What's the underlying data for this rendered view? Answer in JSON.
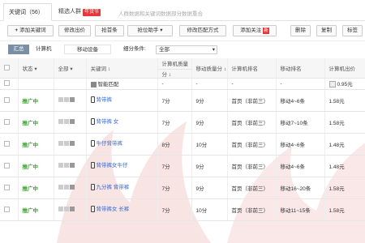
{
  "tabs": {
    "keywords": "关键词（56）",
    "crowd": "精选人群",
    "crowd_badge": "年货节",
    "hint": "人群数据和关键词数据部分数据重合"
  },
  "toolbar": {
    "add_keyword": "添加关键词",
    "modify_bid": "修改出价",
    "grab_rank": "抢首条",
    "grab_helper": "抢位助手",
    "match_mode": "修改匹配方式",
    "add_follow": "添加关注",
    "add_follow_badge": "新",
    "delete": "删除",
    "copy": "复制",
    "tag": "标签"
  },
  "filter": {
    "summary": "汇总",
    "pc": "计算机",
    "mobile": "移动设备",
    "condition_label": "细分条件:",
    "condition_value": "全部"
  },
  "table": {
    "headers": {
      "status": "状态",
      "all": "全部",
      "keyword": "关键词",
      "pc_quality": "计算机质量",
      "pc_quality_sub": "分",
      "mobile_quality": "移动质量分",
      "pc_rank": "计算机排名",
      "mobile_rank": "移动排名",
      "pc_bid": "计算机出价"
    },
    "smart_row": {
      "keyword": "智能匹配",
      "pc_quality": "-",
      "mobile_quality": "-",
      "pc_rank": "-",
      "mobile_rank": "-",
      "pc_bid": "0.95元"
    },
    "rows": [
      {
        "status": "推广中",
        "keyword": "背带裤",
        "pc_quality": "7分",
        "mobile_quality": "9分",
        "pc_rank": "首页（非前三）",
        "mobile_rank": "移动4~6条",
        "pc_bid": "1.58元"
      },
      {
        "status": "推广中",
        "keyword": "背带裤 女",
        "pc_quality": "7分",
        "mobile_quality": "9分",
        "pc_rank": "首页（非前三）",
        "mobile_rank": "移动7~10条",
        "pc_bid": "1.58元"
      },
      {
        "status": "推广中",
        "keyword": "牛仔背带裤",
        "pc_quality": "8分",
        "mobile_quality": "10分",
        "pc_rank": "首页（非前三）",
        "mobile_rank": "移动4~6条",
        "pc_bid": "1.48元"
      },
      {
        "status": "推广中",
        "keyword": "背带裤女牛仔",
        "pc_quality": "7分",
        "mobile_quality": "9分",
        "pc_rank": "首页（非前三）",
        "mobile_rank": "移动4~6条",
        "pc_bid": "1.48元"
      },
      {
        "status": "推广中",
        "keyword": "九分裤 背带裤",
        "pc_quality": "7分",
        "mobile_quality": "9分",
        "pc_rank": "首页（非前三）",
        "mobile_rank": "移动16~20条",
        "pc_bid": "1.58元"
      },
      {
        "status": "推广中",
        "keyword": "背带裤女 长裤",
        "pc_quality": "7分",
        "mobile_quality": "10分",
        "pc_rank": "首页（非前三）",
        "mobile_rank": "移动11~15条",
        "pc_bid": "1.58元"
      }
    ]
  }
}
